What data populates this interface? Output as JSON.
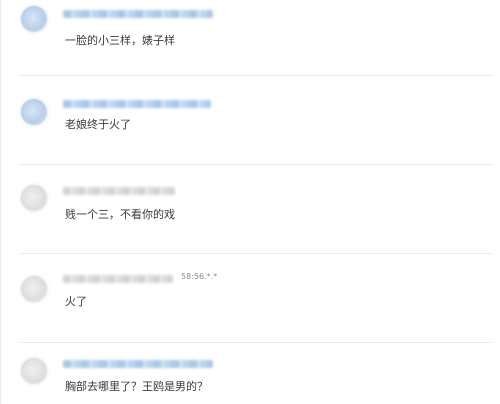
{
  "comments": [
    {
      "avatar_style": "blue",
      "name_style": "blue",
      "text": "一脸的小三样，婊子样",
      "meta": ""
    },
    {
      "avatar_style": "blue",
      "name_style": "blue",
      "text": "老娘终于火了",
      "meta": ""
    },
    {
      "avatar_style": "gray",
      "name_style": "gray",
      "text": "贱一个三，不看你的戏",
      "meta": ""
    },
    {
      "avatar_style": "gray",
      "name_style": "gray",
      "text": "火了",
      "meta": "58:56.*.*"
    },
    {
      "avatar_style": "gray",
      "name_style": "blue",
      "text": "胸部去哪里了？王鸥是男的？",
      "meta": ""
    }
  ]
}
